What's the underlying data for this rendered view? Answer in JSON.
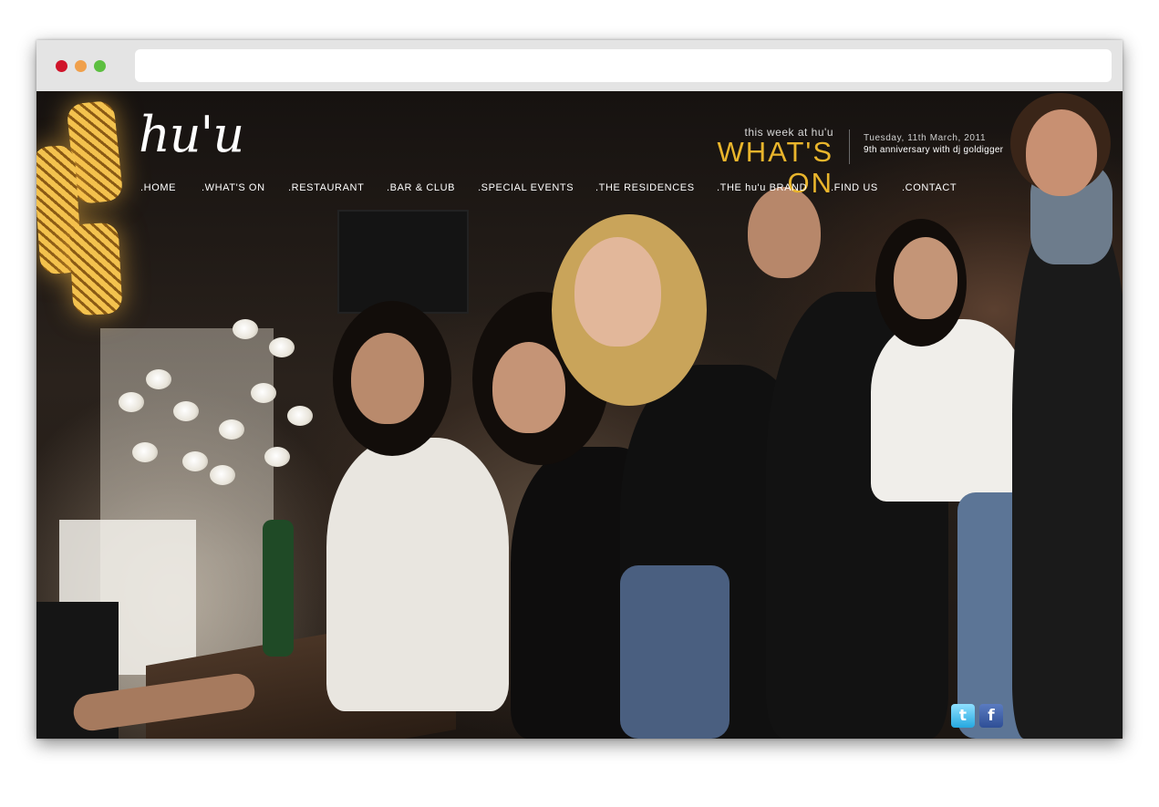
{
  "browser": {
    "controls": [
      "close",
      "minimize",
      "maximize"
    ],
    "address": ""
  },
  "site": {
    "logo": "hu'u",
    "header": {
      "tagline": "this week at hu'u",
      "title": "WHAT'S ON",
      "date": "Tuesday, 11th March, 2011",
      "event": "9th anniversary with dj goldigger",
      "title_color": "#e9b52c"
    },
    "nav": [
      {
        "label": ".HOME"
      },
      {
        "label": ".WHAT'S ON"
      },
      {
        "label": ".RESTAURANT"
      },
      {
        "label": ".BAR & CLUB"
      },
      {
        "label": ".SPECIAL EVENTS"
      },
      {
        "label": ".THE RESIDENCES"
      },
      {
        "label": ".THE hu'u BRAND"
      },
      {
        "label": ".FIND US"
      },
      {
        "label": ".CONTACT"
      }
    ],
    "social": [
      {
        "name": "twitter-icon",
        "glyph": "t"
      },
      {
        "name": "facebook-icon",
        "glyph": "f"
      }
    ]
  }
}
